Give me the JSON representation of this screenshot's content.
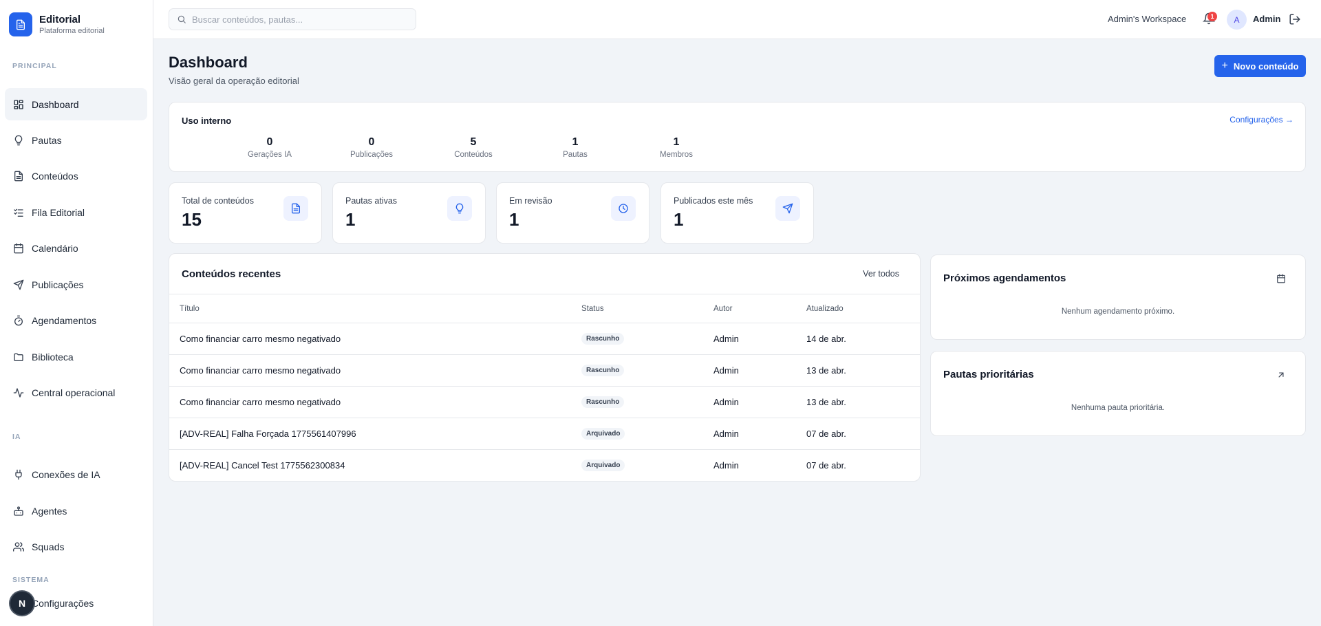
{
  "brand": {
    "name": "Editorial",
    "subtitle": "Plataforma editorial"
  },
  "sidebar": {
    "sections": [
      {
        "label": "PRINCIPAL"
      },
      {
        "label": "IA"
      },
      {
        "label": "SISTEMA"
      }
    ],
    "items": [
      {
        "label": "Dashboard",
        "icon": "dashboard-icon",
        "active": true
      },
      {
        "label": "Pautas",
        "icon": "lightbulb-icon"
      },
      {
        "label": "Conteúdos",
        "icon": "file-text-icon"
      },
      {
        "label": "Fila Editorial",
        "icon": "list-checks-icon"
      },
      {
        "label": "Calendário",
        "icon": "calendar-icon"
      },
      {
        "label": "Publicações",
        "icon": "send-icon"
      },
      {
        "label": "Agendamentos",
        "icon": "timer-icon"
      },
      {
        "label": "Biblioteca",
        "icon": "folder-icon"
      },
      {
        "label": "Central operacional",
        "icon": "activity-icon"
      },
      {
        "label": "Conexões de IA",
        "icon": "plug-icon"
      },
      {
        "label": "Agentes",
        "icon": "bot-icon"
      },
      {
        "label": "Squads",
        "icon": "users-icon"
      },
      {
        "label": "Configurações",
        "icon": "settings-icon"
      }
    ],
    "fab_label": "N"
  },
  "topbar": {
    "search_placeholder": "Buscar conteúdos, pautas...",
    "workspace": "Admin's Workspace",
    "notifications_count": "1",
    "avatar_initial": "A",
    "user_name": "Admin"
  },
  "page": {
    "title": "Dashboard",
    "subtitle": "Visão geral da operação editorial",
    "new_button": "Novo conteúdo"
  },
  "usage": {
    "title": "Uso interno",
    "link": "Configurações →",
    "stats": [
      {
        "value": "0",
        "label": "Gerações IA"
      },
      {
        "value": "0",
        "label": "Publicações"
      },
      {
        "value": "5",
        "label": "Conteúdos"
      },
      {
        "value": "1",
        "label": "Pautas"
      },
      {
        "value": "1",
        "label": "Membros"
      }
    ]
  },
  "kpis": [
    {
      "label": "Total de conteúdos",
      "value": "15",
      "icon": "file-text-icon"
    },
    {
      "label": "Pautas ativas",
      "value": "1",
      "icon": "lightbulb-icon"
    },
    {
      "label": "Em revisão",
      "value": "1",
      "icon": "clock-icon"
    },
    {
      "label": "Publicados este mês",
      "value": "1",
      "icon": "send-icon"
    }
  ],
  "recent": {
    "title": "Conteúdos recentes",
    "see_all": "Ver todos",
    "columns": [
      "Título",
      "Status",
      "Autor",
      "Atualizado"
    ],
    "rows": [
      {
        "title": "Como financiar carro mesmo negativado",
        "status": "Rascunho",
        "author": "Admin",
        "updated": "14 de abr."
      },
      {
        "title": "Como financiar carro mesmo negativado",
        "status": "Rascunho",
        "author": "Admin",
        "updated": "13 de abr."
      },
      {
        "title": "Como financiar carro mesmo negativado",
        "status": "Rascunho",
        "author": "Admin",
        "updated": "13 de abr."
      },
      {
        "title": "[ADV-REAL] Falha Forçada 1775561407996",
        "status": "Arquivado",
        "author": "Admin",
        "updated": "07 de abr."
      },
      {
        "title": "[ADV-REAL] Cancel Test 1775562300834",
        "status": "Arquivado",
        "author": "Admin",
        "updated": "07 de abr."
      }
    ]
  },
  "upcoming": {
    "title": "Próximos agendamentos",
    "empty": "Nenhum agendamento próximo.",
    "icon": "calendar-icon"
  },
  "priority": {
    "title": "Pautas prioritárias",
    "empty": "Nenhuma pauta prioritária.",
    "icon": "arrow-up-right-icon"
  },
  "colors": {
    "accent": "#2563eb",
    "background": "#f1f4f8",
    "badge_red": "#ef4444"
  }
}
